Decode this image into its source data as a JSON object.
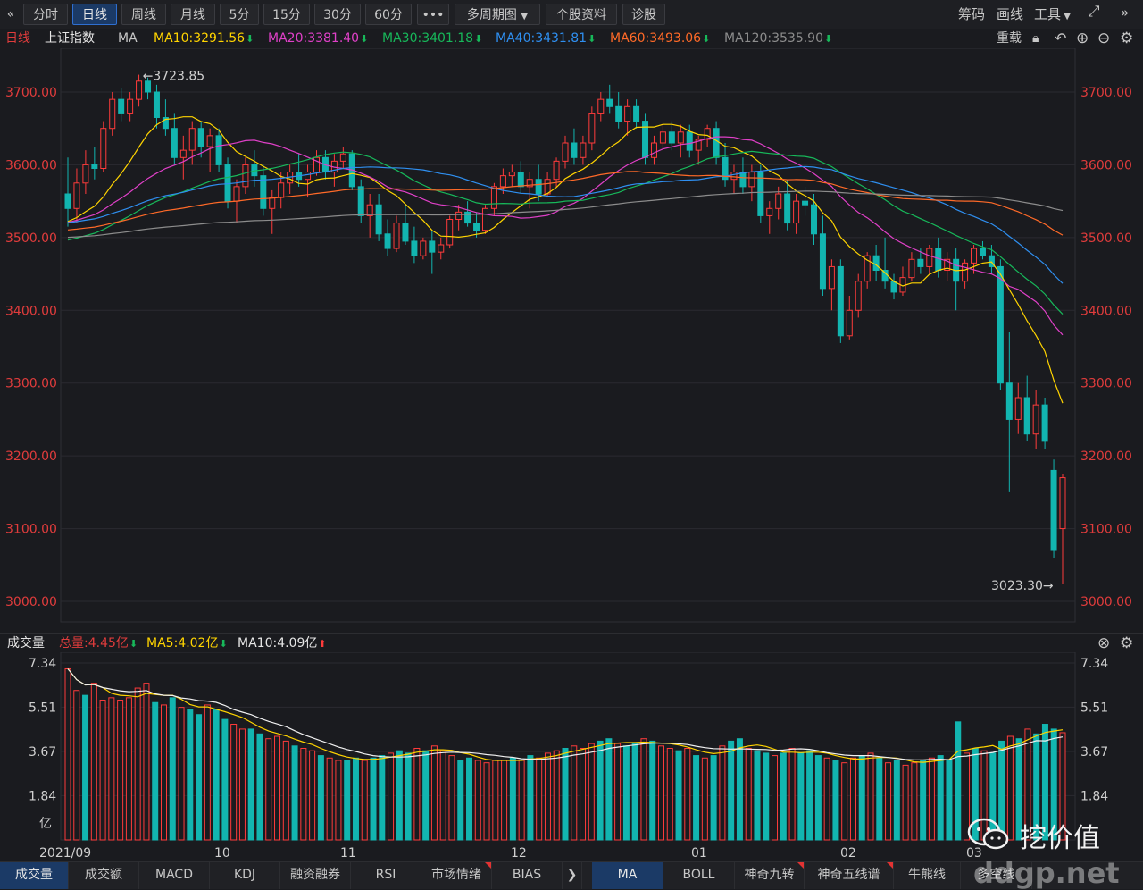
{
  "toolbar": {
    "back": "«",
    "tabs": [
      "分时",
      "日线",
      "周线",
      "月线",
      "5分",
      "15分",
      "30分",
      "60分"
    ],
    "active_tab": "日线",
    "more": "•••",
    "multi_period": "多周期图",
    "stock_info": "个股资料",
    "diagnose": "诊股",
    "chips": "筹码",
    "draw": "画线",
    "tools": "工具",
    "expand_icon": "expand-icon",
    "forward": "»"
  },
  "ma_bar": {
    "period": "日线",
    "index_name": "上证指数",
    "ma_label": "MA",
    "ma10": "MA10:3291.56",
    "ma20": "MA20:3381.40",
    "ma30": "MA30:3401.18",
    "ma40": "MA40:3431.81",
    "ma60": "MA60:3493.06",
    "ma120": "MA120:3535.90",
    "adjust": "重载"
  },
  "colors": {
    "up": "#ff3b3b",
    "down": "#12b5b0",
    "ma10": "#ffd400",
    "ma20": "#e040c8",
    "ma30": "#17b85a",
    "ma40": "#2f8ff0",
    "ma60": "#ff6a28",
    "ma120": "#8c8c8c",
    "axis_label": "#e03c3c"
  },
  "volume_bar": {
    "title": "成交量",
    "total": "总量:4.45亿",
    "ma5": "MA5:4.02亿",
    "ma10": "MA10:4.09亿"
  },
  "bottom_tabs": [
    {
      "label": "成交量",
      "active": true,
      "flag": false
    },
    {
      "label": "成交额",
      "active": false,
      "flag": false
    },
    {
      "label": "MACD",
      "active": false,
      "flag": false
    },
    {
      "label": "KDJ",
      "active": false,
      "flag": false
    },
    {
      "label": "融资融券",
      "active": false,
      "flag": false
    },
    {
      "label": "RSI",
      "active": false,
      "flag": false
    },
    {
      "label": "市场情绪",
      "active": false,
      "flag": true
    },
    {
      "label": "BIAS",
      "active": false,
      "flag": false
    }
  ],
  "bottom_tabs_right": [
    {
      "label": "MA",
      "active": true,
      "flag": false
    },
    {
      "label": "BOLL",
      "active": false,
      "flag": false
    },
    {
      "label": "神奇九转",
      "active": false,
      "flag": true
    },
    {
      "label": "神奇五线谱",
      "active": false,
      "flag": true
    },
    {
      "label": "牛熊线",
      "active": false,
      "flag": false
    },
    {
      "label": "多空线",
      "active": false,
      "flag": false
    }
  ],
  "watermark": {
    "text": "挖价值",
    "url": "ddgp.net",
    "logo_icon": "wechat-icon"
  },
  "chart_data": [
    {
      "type": "candlestick",
      "title": "上证指数 日线",
      "x_labels": [
        "2021/09",
        "10",
        "11",
        "12",
        "01",
        "02",
        "03"
      ],
      "y_ticks": [
        "3700.00",
        "3600.00",
        "3500.00",
        "3400.00",
        "3300.00",
        "3200.00",
        "3100.00",
        "3000.00"
      ],
      "ylim": [
        2990,
        3750
      ],
      "high_annotation": "←3723.85",
      "low_annotation": "3023.30→",
      "series": [
        {
          "name": "MA10",
          "last": 3291.56
        },
        {
          "name": "MA20",
          "last": 3381.4
        },
        {
          "name": "MA30",
          "last": 3401.18
        },
        {
          "name": "MA40",
          "last": 3431.81
        },
        {
          "name": "MA60",
          "last": 3493.06
        },
        {
          "name": "MA120",
          "last": 3535.9
        }
      ],
      "ohlc": [
        [
          3560,
          3610,
          3515,
          3540
        ],
        [
          3540,
          3595,
          3520,
          3575
        ],
        [
          3575,
          3620,
          3560,
          3600
        ],
        [
          3600,
          3625,
          3580,
          3595
        ],
        [
          3595,
          3660,
          3590,
          3650
        ],
        [
          3650,
          3700,
          3640,
          3690
        ],
        [
          3690,
          3705,
          3660,
          3670
        ],
        [
          3670,
          3700,
          3660,
          3690
        ],
        [
          3690,
          3723.85,
          3680,
          3715
        ],
        [
          3715,
          3720,
          3690,
          3700
        ],
        [
          3700,
          3710,
          3650,
          3665
        ],
        [
          3665,
          3690,
          3640,
          3650
        ],
        [
          3650,
          3670,
          3600,
          3610
        ],
        [
          3610,
          3640,
          3580,
          3620
        ],
        [
          3620,
          3660,
          3600,
          3650
        ],
        [
          3650,
          3660,
          3610,
          3625
        ],
        [
          3625,
          3650,
          3590,
          3640
        ],
        [
          3640,
          3650,
          3590,
          3600
        ],
        [
          3600,
          3610,
          3540,
          3550
        ],
        [
          3550,
          3580,
          3520,
          3570
        ],
        [
          3570,
          3610,
          3560,
          3600
        ],
        [
          3600,
          3620,
          3570,
          3585
        ],
        [
          3585,
          3600,
          3530,
          3540
        ],
        [
          3540,
          3565,
          3505,
          3555
        ],
        [
          3555,
          3590,
          3540,
          3575
        ],
        [
          3575,
          3600,
          3560,
          3590
        ],
        [
          3590,
          3615,
          3570,
          3580
        ],
        [
          3580,
          3600,
          3555,
          3590
        ],
        [
          3590,
          3620,
          3585,
          3610
        ],
        [
          3610,
          3620,
          3580,
          3590
        ],
        [
          3590,
          3615,
          3570,
          3605
        ],
        [
          3605,
          3625,
          3595,
          3615
        ],
        [
          3615,
          3620,
          3565,
          3570
        ],
        [
          3570,
          3580,
          3520,
          3530
        ],
        [
          3530,
          3560,
          3500,
          3545
        ],
        [
          3545,
          3560,
          3495,
          3505
        ],
        [
          3505,
          3525,
          3475,
          3485
        ],
        [
          3485,
          3530,
          3480,
          3520
        ],
        [
          3520,
          3545,
          3490,
          3495
        ],
        [
          3495,
          3515,
          3465,
          3475
        ],
        [
          3475,
          3500,
          3470,
          3495
        ],
        [
          3495,
          3510,
          3450,
          3480
        ],
        [
          3480,
          3500,
          3470,
          3490
        ],
        [
          3490,
          3530,
          3485,
          3525
        ],
        [
          3525,
          3545,
          3510,
          3535
        ],
        [
          3535,
          3550,
          3515,
          3520
        ],
        [
          3520,
          3535,
          3500,
          3510
        ],
        [
          3510,
          3545,
          3505,
          3540
        ],
        [
          3540,
          3575,
          3530,
          3570
        ],
        [
          3570,
          3595,
          3560,
          3585
        ],
        [
          3585,
          3600,
          3570,
          3590
        ],
        [
          3590,
          3605,
          3560,
          3570
        ],
        [
          3570,
          3590,
          3540,
          3580
        ],
        [
          3580,
          3600,
          3550,
          3560
        ],
        [
          3560,
          3590,
          3555,
          3580
        ],
        [
          3580,
          3610,
          3570,
          3605
        ],
        [
          3605,
          3640,
          3595,
          3630
        ],
        [
          3630,
          3650,
          3600,
          3610
        ],
        [
          3610,
          3640,
          3600,
          3630
        ],
        [
          3630,
          3680,
          3620,
          3670
        ],
        [
          3670,
          3700,
          3660,
          3690
        ],
        [
          3690,
          3710,
          3670,
          3680
        ],
        [
          3680,
          3700,
          3650,
          3660
        ],
        [
          3660,
          3690,
          3640,
          3680
        ],
        [
          3680,
          3690,
          3650,
          3660
        ],
        [
          3660,
          3670,
          3600,
          3610
        ],
        [
          3610,
          3640,
          3600,
          3630
        ],
        [
          3630,
          3655,
          3620,
          3645
        ],
        [
          3645,
          3660,
          3620,
          3630
        ],
        [
          3630,
          3655,
          3610,
          3645
        ],
        [
          3645,
          3655,
          3610,
          3620
        ],
        [
          3620,
          3640,
          3600,
          3635
        ],
        [
          3635,
          3655,
          3625,
          3650
        ],
        [
          3650,
          3660,
          3600,
          3610
        ],
        [
          3610,
          3630,
          3570,
          3580
        ],
        [
          3580,
          3600,
          3560,
          3590
        ],
        [
          3590,
          3610,
          3560,
          3570
        ],
        [
          3570,
          3600,
          3550,
          3590
        ],
        [
          3590,
          3600,
          3520,
          3530
        ],
        [
          3530,
          3550,
          3505,
          3540
        ],
        [
          3540,
          3570,
          3525,
          3560
        ],
        [
          3560,
          3580,
          3510,
          3520
        ],
        [
          3520,
          3560,
          3505,
          3550
        ],
        [
          3550,
          3570,
          3530,
          3545
        ],
        [
          3545,
          3560,
          3490,
          3505
        ],
        [
          3505,
          3530,
          3420,
          3430
        ],
        [
          3430,
          3470,
          3400,
          3460
        ],
        [
          3460,
          3470,
          3355,
          3365
        ],
        [
          3365,
          3420,
          3360,
          3400
        ],
        [
          3400,
          3450,
          3390,
          3440
        ],
        [
          3440,
          3480,
          3430,
          3475
        ],
        [
          3475,
          3490,
          3440,
          3455
        ],
        [
          3455,
          3500,
          3430,
          3440
        ],
        [
          3440,
          3450,
          3415,
          3425
        ],
        [
          3425,
          3460,
          3420,
          3445
        ],
        [
          3445,
          3480,
          3440,
          3470
        ],
        [
          3470,
          3485,
          3450,
          3460
        ],
        [
          3460,
          3490,
          3450,
          3485
        ],
        [
          3485,
          3500,
          3445,
          3455
        ],
        [
          3455,
          3480,
          3440,
          3470
        ],
        [
          3470,
          3485,
          3400,
          3440
        ],
        [
          3440,
          3470,
          3430,
          3465
        ],
        [
          3465,
          3490,
          3450,
          3485
        ],
        [
          3485,
          3495,
          3470,
          3475
        ],
        [
          3475,
          3490,
          3450,
          3460
        ],
        [
          3460,
          3470,
          3290,
          3300
        ],
        [
          3300,
          3370,
          3150,
          3250
        ],
        [
          3250,
          3300,
          3230,
          3280
        ],
        [
          3280,
          3310,
          3220,
          3230
        ],
        [
          3230,
          3290,
          3210,
          3270
        ],
        [
          3270,
          3280,
          3210,
          3220
        ],
        [
          3180,
          3195,
          3060,
          3070
        ],
        [
          3100,
          3175,
          3023.3,
          3170
        ]
      ]
    },
    {
      "type": "bar",
      "title": "成交量",
      "y_ticks": [
        "7.34",
        "5.51",
        "3.67",
        "1.84",
        "亿"
      ],
      "y_ticks_right": [
        "7.34",
        "5.51",
        "3.67",
        "1.84"
      ],
      "ylim": [
        0,
        7.34
      ],
      "unit": "亿",
      "values": [
        7.1,
        6.2,
        6.0,
        6.5,
        5.8,
        5.9,
        5.8,
        5.9,
        6.3,
        6.5,
        5.7,
        5.6,
        5.9,
        5.5,
        5.4,
        5.2,
        5.6,
        5.4,
        5.0,
        4.8,
        4.6,
        4.6,
        4.4,
        4.2,
        4.3,
        4.1,
        3.9,
        3.8,
        3.7,
        3.5,
        3.4,
        3.3,
        3.3,
        3.4,
        3.3,
        3.4,
        3.5,
        3.6,
        3.7,
        3.6,
        3.8,
        3.7,
        3.9,
        3.7,
        3.5,
        3.3,
        3.4,
        3.3,
        3.2,
        3.3,
        3.3,
        3.4,
        3.3,
        3.5,
        3.4,
        3.6,
        3.7,
        3.8,
        3.9,
        3.8,
        4.0,
        4.1,
        4.2,
        4.0,
        3.9,
        4.0,
        4.2,
        4.1,
        3.9,
        3.8,
        3.7,
        3.8,
        3.5,
        3.4,
        3.5,
        3.9,
        4.1,
        4.2,
        3.8,
        3.7,
        3.6,
        3.5,
        3.6,
        3.8,
        3.6,
        3.7,
        3.5,
        3.4,
        3.3,
        3.2,
        3.4,
        3.5,
        3.6,
        3.4,
        3.2,
        3.3,
        3.1,
        3.2,
        3.3,
        3.4,
        3.5,
        3.3,
        4.9,
        3.6,
        3.8,
        3.7,
        3.6,
        4.1,
        4.3,
        4.2,
        4.6,
        4.4,
        4.8,
        4.6,
        4.45
      ],
      "ups": [
        1,
        1,
        0,
        1,
        1,
        1,
        1,
        1,
        1,
        1,
        0,
        1,
        0,
        1,
        0,
        0,
        1,
        0,
        0,
        1,
        1,
        0,
        0,
        1,
        1,
        1,
        0,
        1,
        1,
        0,
        1,
        1,
        0,
        0,
        1,
        0,
        0,
        1,
        0,
        0,
        1,
        0,
        1,
        1,
        1,
        0,
        0,
        1,
        1,
        1,
        1,
        0,
        1,
        0,
        1,
        1,
        1,
        0,
        1,
        1,
        1,
        0,
        0,
        1,
        0,
        0,
        1,
        0,
        1,
        1,
        0,
        1,
        0,
        1,
        0,
        1,
        0,
        0,
        1,
        0,
        0,
        1,
        0,
        1,
        0,
        0,
        0,
        1,
        0,
        1,
        1,
        0,
        1,
        0,
        1,
        0,
        1,
        1,
        0,
        1,
        0,
        0,
        0,
        1,
        0,
        1,
        0,
        0,
        1,
        0,
        1,
        0,
        0,
        0,
        1
      ]
    }
  ]
}
